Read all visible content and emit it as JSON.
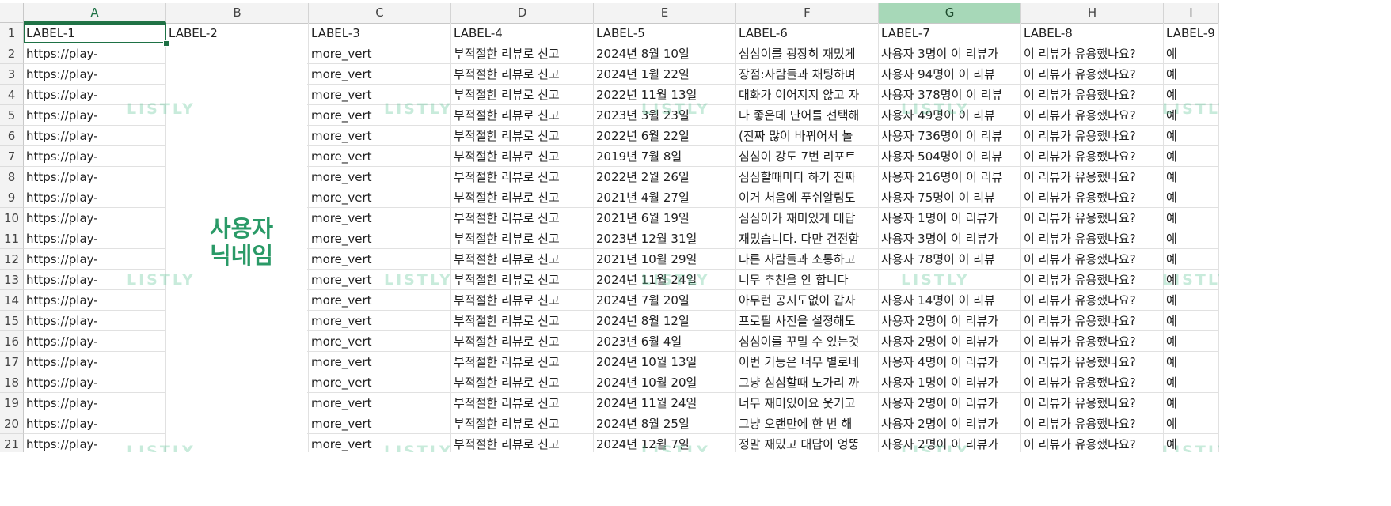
{
  "columns": [
    "A",
    "B",
    "C",
    "D",
    "E",
    "F",
    "G",
    "H",
    "I"
  ],
  "row_numbers": [
    "1",
    "2",
    "3",
    "4",
    "5",
    "6",
    "7",
    "8",
    "9",
    "10",
    "11",
    "12",
    "13",
    "14",
    "15",
    "16",
    "17",
    "18",
    "19",
    "20",
    "21"
  ],
  "header_row": [
    "LABEL-1",
    "LABEL-2",
    "LABEL-3",
    "LABEL-4",
    "LABEL-5",
    "LABEL-6",
    "LABEL-7",
    "LABEL-8",
    "LABEL-9"
  ],
  "rows": [
    [
      "https://play-",
      "",
      "more_vert",
      "부적절한 리뷰로 신고",
      "2024년 8월 10일",
      "심심이를 굉장히 재밌게",
      "사용자 3명이 이 리뷰가",
      "이 리뷰가 유용했나요?",
      "예"
    ],
    [
      "https://play-",
      "",
      "more_vert",
      "부적절한 리뷰로 신고",
      "2024년 1월 22일",
      "장점:사람들과 채팅하며",
      "사용자 94명이 이 리뷰",
      "이 리뷰가 유용했나요?",
      "예"
    ],
    [
      "https://play-",
      "",
      "more_vert",
      "부적절한 리뷰로 신고",
      "2022년 11월 13일",
      "대화가 이어지지 않고 자",
      "사용자 378명이 이 리뷰",
      "이 리뷰가 유용했나요?",
      "예"
    ],
    [
      "https://play-",
      "",
      "more_vert",
      "부적절한 리뷰로 신고",
      "2023년 3월 23일",
      "다 좋은데 단어를 선택해",
      "사용자 49명이 이 리뷰",
      "이 리뷰가 유용했나요?",
      "예"
    ],
    [
      "https://play-",
      "",
      "more_vert",
      "부적절한 리뷰로 신고",
      "2022년 6월 22일",
      "(진짜 많이 바뀌어서 놀",
      "사용자 736명이 이 리뷰",
      "이 리뷰가 유용했나요?",
      "예"
    ],
    [
      "https://play-",
      "",
      "more_vert",
      "부적절한 리뷰로 신고",
      "2019년 7월 8일",
      "심심이 강도 7번 리포트",
      "사용자 504명이 이 리뷰",
      "이 리뷰가 유용했나요?",
      "예"
    ],
    [
      "https://play-",
      "",
      "more_vert",
      "부적절한 리뷰로 신고",
      "2022년 2월 26일",
      "심심할때마다 하기 진짜",
      "사용자 216명이 이 리뷰",
      "이 리뷰가 유용했나요?",
      "예"
    ],
    [
      "https://play-",
      "",
      "more_vert",
      "부적절한 리뷰로 신고",
      "2021년 4월 27일",
      "이거 처음에 푸쉬알림도",
      "사용자 75명이 이 리뷰",
      "이 리뷰가 유용했나요?",
      "예"
    ],
    [
      "https://play-",
      "",
      "more_vert",
      "부적절한 리뷰로 신고",
      "2021년 6월 19일",
      "심심이가 재미있게 대답",
      "사용자 1명이 이 리뷰가",
      "이 리뷰가 유용했나요?",
      "예"
    ],
    [
      "https://play-",
      "",
      "more_vert",
      "부적절한 리뷰로 신고",
      "2023년 12월 31일",
      "재밌습니다. 다만 건전함",
      "사용자 3명이 이 리뷰가",
      "이 리뷰가 유용했나요?",
      "예"
    ],
    [
      "https://play-",
      "",
      "more_vert",
      "부적절한 리뷰로 신고",
      "2021년 10월 29일",
      "다른 사람들과 소통하고",
      "사용자 78명이 이 리뷰",
      "이 리뷰가 유용했나요?",
      "예"
    ],
    [
      "https://play-",
      "",
      "more_vert",
      "부적절한 리뷰로 신고",
      "2024년 11월 24일",
      "너무 추천을 안 합니다",
      "",
      "이 리뷰가 유용했나요?",
      "예"
    ],
    [
      "https://play-",
      "",
      "more_vert",
      "부적절한 리뷰로 신고",
      "2024년 7월 20일",
      "아무런 공지도없이 갑자",
      "사용자 14명이 이 리뷰",
      "이 리뷰가 유용했나요?",
      "예"
    ],
    [
      "https://play-",
      "",
      "more_vert",
      "부적절한 리뷰로 신고",
      "2024년 8월 12일",
      "프로필 사진을 설정해도",
      "사용자 2명이 이 리뷰가",
      "이 리뷰가 유용했나요?",
      "예"
    ],
    [
      "https://play-",
      "",
      "more_vert",
      "부적절한 리뷰로 신고",
      "2023년 6월 4일",
      "심심이를 꾸밀 수 있는것",
      "사용자 2명이 이 리뷰가",
      "이 리뷰가 유용했나요?",
      "예"
    ],
    [
      "https://play-",
      "",
      "more_vert",
      "부적절한 리뷰로 신고",
      "2024년 10월 13일",
      "이번 기능은 너무 별로네",
      "사용자 4명이 이 리뷰가",
      "이 리뷰가 유용했나요?",
      "예"
    ],
    [
      "https://play-",
      "",
      "more_vert",
      "부적절한 리뷰로 신고",
      "2024년 10월 20일",
      "그냥 심심할때 노가리 까",
      "사용자 1명이 이 리뷰가",
      "이 리뷰가 유용했나요?",
      "예"
    ],
    [
      "https://play-",
      "",
      "more_vert",
      "부적절한 리뷰로 신고",
      "2024년 11월 24일",
      "너무 재미있어요 웃기고",
      "사용자 2명이 이 리뷰가",
      "이 리뷰가 유용했나요?",
      "예"
    ],
    [
      "https://play-",
      "",
      "more_vert",
      "부적절한 리뷰로 신고",
      "2024년 8월 25일",
      "그냥 오랜만에 한 번 해",
      "사용자 2명이 이 리뷰가",
      "이 리뷰가 유용했나요?",
      "예"
    ],
    [
      "https://play-",
      "",
      "more_vert",
      "부적절한 리뷰로 신고",
      "2024년 12월 7일",
      "정말 재밌고 대답이 엉뚱",
      "사용자 2명이 이 리뷰가",
      "이 리뷰가 유용했나요?",
      "예"
    ]
  ],
  "annotation": {
    "line1": "사용자",
    "line2": "닉네임"
  },
  "watermark": "LISTLY",
  "selected_cell": "A1",
  "highlighted_column": "G",
  "colors": {
    "selection": "#1e7145",
    "highlight_header": "#a7d8b8",
    "annotation": "#2a9a67",
    "watermark": "#63c79a"
  }
}
